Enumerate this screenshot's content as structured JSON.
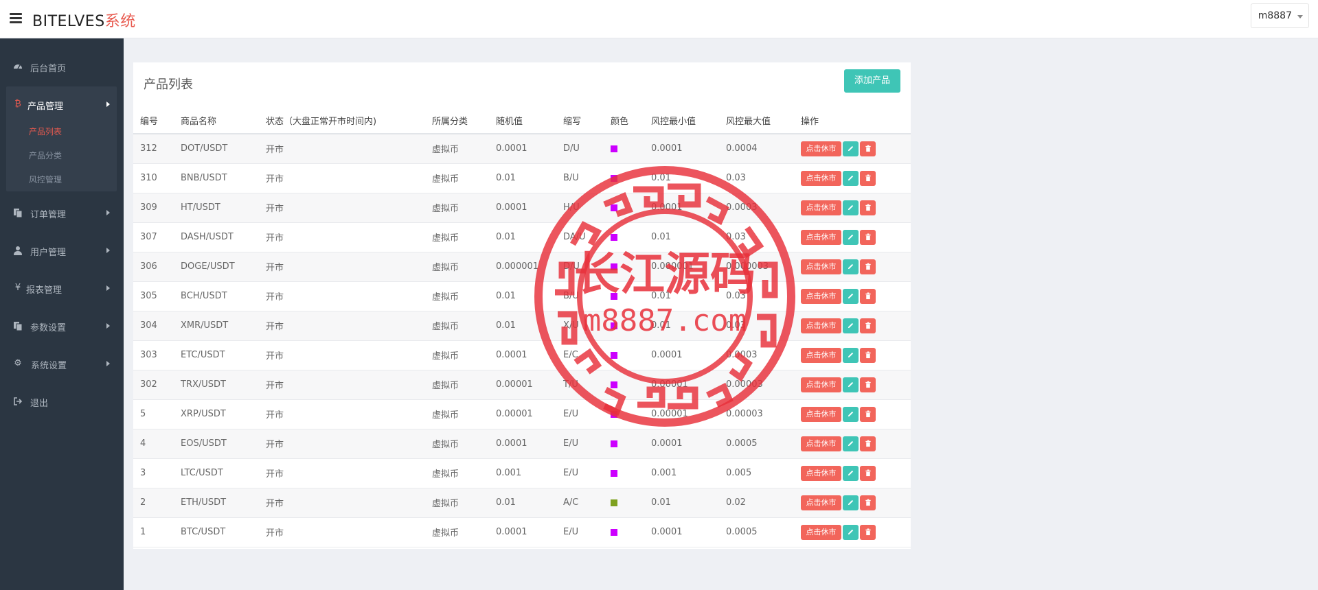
{
  "header": {
    "brand_main": "BITELVES",
    "brand_accent": "系统",
    "user_label": "m8887"
  },
  "sidebar": {
    "items": [
      {
        "label": "后台首页",
        "icon": "dashboard-icon"
      },
      {
        "label": "产品管理",
        "icon": "bitcoin-icon"
      },
      {
        "label": "订单管理",
        "icon": "files-icon"
      },
      {
        "label": "用户管理",
        "icon": "user-icon"
      },
      {
        "label": "报表管理",
        "icon": "yen-icon"
      },
      {
        "label": "参数设置",
        "icon": "files-icon"
      },
      {
        "label": "系统设置",
        "icon": "cogs-icon"
      },
      {
        "label": "退出",
        "icon": "sign-out-icon"
      }
    ],
    "subitems": [
      "产品列表",
      "产品分类",
      "风控管理"
    ]
  },
  "panel": {
    "title": "产品列表",
    "add_button": "添加产品"
  },
  "table": {
    "headers": [
      "编号",
      "商品名称",
      "状态（大盘正常开市时间内)",
      "所属分类",
      "随机值",
      "缩写",
      "颜色",
      "风控最小值",
      "风控最大值",
      "操作"
    ],
    "action_label": "点击休市",
    "rows": [
      {
        "id": "312",
        "name": "DOT/USDT",
        "status": "开市",
        "category": "虚拟币",
        "random": "0.0001",
        "abbr": "D/U",
        "color": "#cc00ff",
        "min": "0.0001",
        "max": "0.0004"
      },
      {
        "id": "310",
        "name": "BNB/USDT",
        "status": "开市",
        "category": "虚拟币",
        "random": "0.01",
        "abbr": "B/U",
        "color": "#cc00ff",
        "min": "0.01",
        "max": "0.03"
      },
      {
        "id": "309",
        "name": "HT/USDT",
        "status": "开市",
        "category": "虚拟币",
        "random": "0.0001",
        "abbr": "H/U",
        "color": "#cc00ff",
        "min": "0.0001",
        "max": "0.0003"
      },
      {
        "id": "307",
        "name": "DASH/USDT",
        "status": "开市",
        "category": "虚拟币",
        "random": "0.01",
        "abbr": "DA/U",
        "color": "#cc00ff",
        "min": "0.01",
        "max": "0.03"
      },
      {
        "id": "306",
        "name": "DOGE/USDT",
        "status": "开市",
        "category": "虚拟币",
        "random": "0.000001",
        "abbr": "D/U",
        "color": "#cc00ff",
        "min": "0.000001",
        "max": "0.000003"
      },
      {
        "id": "305",
        "name": "BCH/USDT",
        "status": "开市",
        "category": "虚拟币",
        "random": "0.01",
        "abbr": "B/U",
        "color": "#cc00ff",
        "min": "0.01",
        "max": "0.03"
      },
      {
        "id": "304",
        "name": "XMR/USDT",
        "status": "开市",
        "category": "虚拟币",
        "random": "0.01",
        "abbr": "X/U",
        "color": "#cc00ff",
        "min": "0.01",
        "max": "0.03"
      },
      {
        "id": "303",
        "name": "ETC/USDT",
        "status": "开市",
        "category": "虚拟币",
        "random": "0.0001",
        "abbr": "E/C",
        "color": "#cc00ff",
        "min": "0.0001",
        "max": "0.0003"
      },
      {
        "id": "302",
        "name": "TRX/USDT",
        "status": "开市",
        "category": "虚拟币",
        "random": "0.00001",
        "abbr": "T/U",
        "color": "#cc00ff",
        "min": "0.00001",
        "max": "0.00003"
      },
      {
        "id": "5",
        "name": "XRP/USDT",
        "status": "开市",
        "category": "虚拟币",
        "random": "0.00001",
        "abbr": "E/U",
        "color": "#cc00ff",
        "min": "0.00001",
        "max": "0.00003"
      },
      {
        "id": "4",
        "name": "EOS/USDT",
        "status": "开市",
        "category": "虚拟币",
        "random": "0.0001",
        "abbr": "E/U",
        "color": "#cc00ff",
        "min": "0.0001",
        "max": "0.0005"
      },
      {
        "id": "3",
        "name": "LTC/USDT",
        "status": "开市",
        "category": "虚拟币",
        "random": "0.001",
        "abbr": "E/U",
        "color": "#cc00ff",
        "min": "0.001",
        "max": "0.005"
      },
      {
        "id": "2",
        "name": "ETH/USDT",
        "status": "开市",
        "category": "虚拟币",
        "random": "0.01",
        "abbr": "A/C",
        "color": "#7ea11f",
        "min": "0.01",
        "max": "0.02"
      },
      {
        "id": "1",
        "name": "BTC/USDT",
        "status": "开市",
        "category": "虚拟币",
        "random": "0.0001",
        "abbr": "E/U",
        "color": "#cc00ff",
        "min": "0.0001",
        "max": "0.0005"
      }
    ]
  },
  "watermark": {
    "line1": "长江源码",
    "line2": "m8887.com"
  },
  "colors": {
    "sidebar_bg": "#2b3642",
    "accent_red": "#e85a4f",
    "accent_teal": "#3fc5b6"
  }
}
